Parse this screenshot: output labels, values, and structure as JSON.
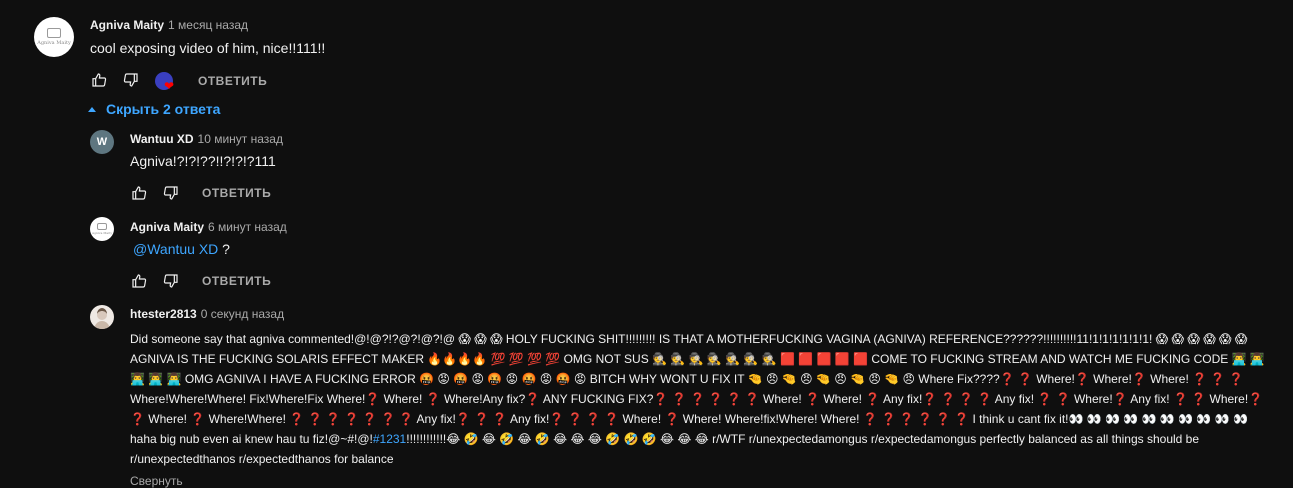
{
  "comments": [
    {
      "author": "Agniva Maity",
      "time": "1 месяц назад",
      "text": "cool exposing video of him, nice!!111!!",
      "avatar_text": "Agniva Maity",
      "reply_label": "ОТВЕТИТЬ"
    }
  ],
  "replies_toggle": {
    "label": "Скрыть 2 ответа"
  },
  "replies": [
    {
      "author": "Wantuu XD",
      "time": "10 минут назад",
      "text": "Agniva!?!?!??!!?!?!?111",
      "avatar_letter": "W",
      "reply_label": "ОТВЕТИТЬ"
    },
    {
      "author": "Agniva Maity",
      "time": "6 минут назад",
      "mention": "@Wantuu XD",
      "text": " ?",
      "avatar_text": "Agniva Maity",
      "reply_label": "ОТВЕТИТЬ"
    },
    {
      "author": "htester2813",
      "time": "0 секунд назад",
      "text_before_hashtag": "Did someone say that agniva commented!@!@?!?@?!@?!@ 😱 😱 😱 HOLY FUCKING SHIT!!!!!!!!! IS THAT A MOTHERFUCKING VAGINA (AGNIVA) REFERENCE??????!!!!!!!!!!11!1!1!1!1!1!1! 😱 😱 😱 😱 😱 😱 AGNIVA IS THE FUCKING SOLARIS EFFECT MAKER 🔥🔥🔥🔥 💯 💯 💯 💯 OMG NOT SUS 🕵 🕵 🕵 🕵 🕵 🕵 🕵 🟥 🟥 🟥 🟥 🟥 COME TO FUCKING STREAM AND WATCH ME FUCKING CODE 👨‍💻 👨‍💻 👨‍💻 👨‍💻 👨‍💻 OMG AGNIVA I HAVE A FUCKING ERROR 🤬 😡 🤬 😡 🤬 😡 🤬 😡 🤬 😡 BITCH WHY WONT U FIX IT 🤏 😠 🤏 😠 🤏 😠 🤏 😠 🤏 😠 Where Fix????❓ ❓ Where!❓ Where!❓ Where! ❓ ❓ ❓ Where!Where!Where! Fix!Where!Fix Where!❓ Where! ❓ Where!Any fix?❓ ANY FUCKING FIX?❓ ❓ ❓ ❓ ❓ ❓ Where! ❓ Where! ❓ Any fix!❓ ❓ ❓ ❓ Any fix! ❓ ❓ Where!❓ Any fix! ❓ ❓ Where!❓ ❓ Where! ❓ Where!Where! ❓ ❓ ❓ ❓ ❓ ❓ ❓ Any fix!❓ ❓ ❓ Any fix!❓ ❓ ❓ ❓ Where! ❓ Where! Where!fix!Where! Where! ❓ ❓ ❓ ❓ ❓ ❓ I think u cant fix it!👀 👀 👀 👀 👀 👀 👀 👀 👀 👀haha big nub even ai knew hau tu fiz!@~#!@!",
      "hashtag": "#1231",
      "text_after_hashtag": "!!!!!!!!!!!!😂 🤣 😂 🤣 😂 🤣 😂 😂 😂 🤣 🤣 🤣 😂 😂 😂 r/WTF r/unexpectedamongus r/expectedamongus perfectly balanced as all things should be r/unexpectedthanos r/expectedthanos for balance",
      "collapse_label": "Свернуть"
    }
  ],
  "colors": {
    "background": "#0f0f0f",
    "text": "#f1f1f1",
    "secondary": "#aaaaaa",
    "link": "#3ea6ff",
    "heart": "#ff0000"
  }
}
